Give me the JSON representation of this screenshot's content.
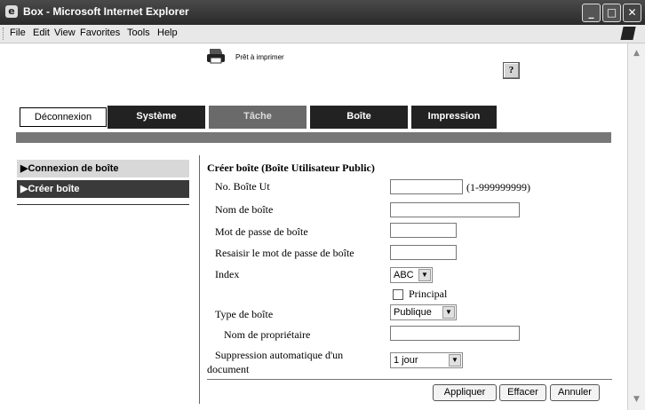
{
  "window": {
    "title": "Box - Microsoft Internet Explorer",
    "controls": {
      "minimize": "_",
      "maximize": "□",
      "close": "✕"
    }
  },
  "menubar": {
    "items": [
      "File",
      "Edit",
      "View",
      "Favorites",
      "Tools",
      "Help"
    ]
  },
  "status": {
    "text": "Prêt à imprimer",
    "icon": "printer-icon"
  },
  "help": {
    "label": "?"
  },
  "nav": {
    "logout": "Déconnexion",
    "tabs": [
      "Système",
      "Tâche",
      "Boîte",
      "Impression"
    ]
  },
  "sidebar": {
    "items": [
      {
        "label": "Connexion de boîte",
        "marker": "▶"
      },
      {
        "label": "Créer boîte",
        "marker": "▶"
      }
    ]
  },
  "form": {
    "title": "Créer boîte (Boîte Utilisateur Public)",
    "box_no_label": "No. Boîte Ut",
    "box_no_value": "",
    "box_no_range": "(1-999999999)",
    "box_name_label": "Nom de boîte",
    "box_name_value": "",
    "password_label": "Mot de passe de boîte",
    "password_value": "",
    "password_confirm_label": "Resaisir le mot de passe de boîte",
    "password_confirm_value": "",
    "index_label": "Index",
    "index_value": "ABC",
    "principal_label": "Principal",
    "principal_checked": false,
    "type_label": "Type de boîte",
    "type_value": "Publique",
    "owner_label": "Nom de propriétaire",
    "owner_value": "",
    "auto_delete_label_1": "Suppression automatique d'un",
    "auto_delete_label_2": "document",
    "auto_delete_value": "1 jour"
  },
  "buttons": {
    "apply": "Appliquer",
    "clear": "Effacer",
    "cancel": "Annuler"
  },
  "colors": {
    "titlebar": "#333333",
    "tab_dark": "#222222",
    "sidebar_selected": "#3a3a3a",
    "sidebar_item": "#d8d8d8"
  }
}
